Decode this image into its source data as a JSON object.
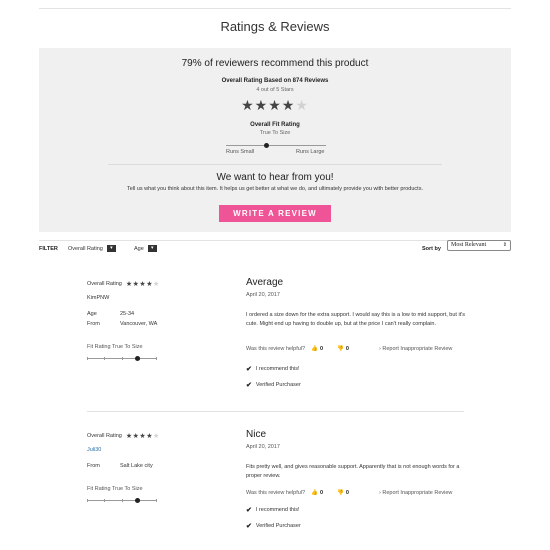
{
  "page": {
    "title": "Ratings & Reviews"
  },
  "summary": {
    "recommend_text": "79% of reviewers recommend this product",
    "overall_label": "Overall Rating Based on 874 Reviews",
    "overall_sub": "4 out of 5 Stars",
    "rating": 4,
    "max_rating": 5,
    "fit_label": "Overall Fit Rating",
    "fit_sub": "True To Size",
    "fit_left": "Runs Small",
    "fit_right": "Runs Large",
    "hear_title": "We want to hear from you!",
    "hear_text": "Tell us what you think about this item. It helps us get better at what we do, and ultimately provide you with better products.",
    "write_button": "WRITE A REVIEW",
    "accent_color": "#ef5596"
  },
  "filters": {
    "label": "FILTER",
    "overall_rating": "Overall Rating",
    "age": "Age",
    "sort_label": "Sort by",
    "sort_value": "Most Relevant"
  },
  "reviews": [
    {
      "overall_label": "Overall Rating",
      "rating": 4,
      "user": "KimPNW",
      "age_label": "Age",
      "age": "25-34",
      "from_label": "From",
      "from": "Vancouver, WA",
      "fit_label": "Fit Rating True To Size",
      "title": "Average",
      "date": "April 20, 2017",
      "body": "I ordered a size down for the extra support. I would say this is a low to mid support, but it's cute. Might end up having to double up, but at the price I can't really complain.",
      "helpful_label": "Was this review helpful?",
      "up_count": "0",
      "down_count": "0",
      "report": "Report Inappropriate Review",
      "recommend": "I recommend this!",
      "verified": "Verified Purchaser"
    },
    {
      "overall_label": "Overall Rating",
      "rating": 4,
      "user": "Juli30",
      "from_label": "From",
      "from": "Salt Lake city",
      "fit_label": "Fit Rating True To Size",
      "title": "Nice",
      "date": "April 20, 2017",
      "body": "Fits pretty well, and gives reasonable support. Apparently that is not enough words for a proper review.",
      "helpful_label": "Was this review helpful?",
      "up_count": "0",
      "down_count": "0",
      "report": "Report Inappropriate Review",
      "recommend": "I recommend this!",
      "verified": "Verified Purchaser"
    }
  ]
}
